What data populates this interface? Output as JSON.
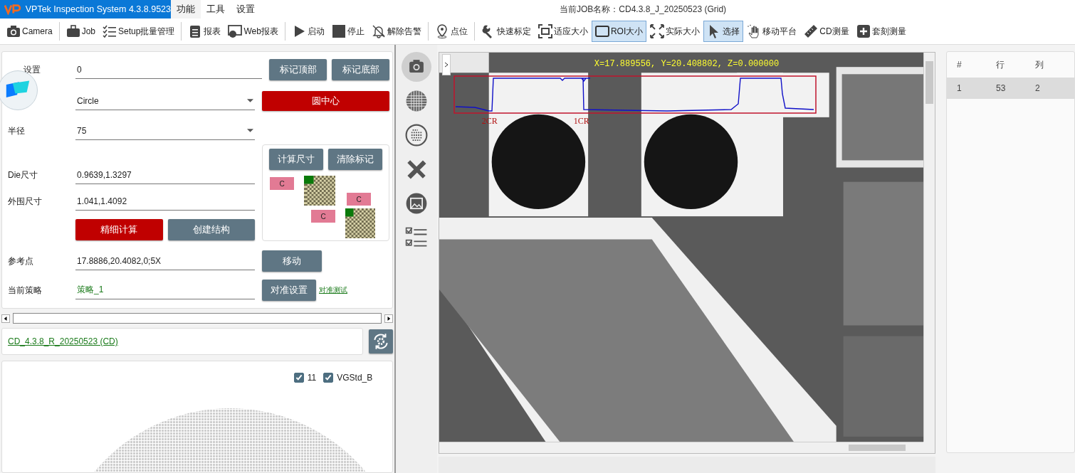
{
  "window": {
    "app_title": "VPTek Inspection System 4.3.8.9523",
    "menu": [
      {
        "label": "功能",
        "selected": true
      },
      {
        "label": "工具",
        "selected": false
      },
      {
        "label": "设置",
        "selected": false
      }
    ],
    "job_title": "当前JOB名称：CD4.3.8_J_20250523 (Grid)"
  },
  "toolbar": {
    "groups": [
      [
        {
          "label": "Camera",
          "selected": false
        }
      ],
      [
        {
          "label": "Job",
          "selected": false
        },
        {
          "label": "Setup批量管理",
          "selected": false
        }
      ],
      [
        {
          "label": "报表",
          "selected": false
        },
        {
          "label": "Web报表",
          "selected": false
        }
      ],
      [
        {
          "label": "启动",
          "selected": false
        },
        {
          "label": "停止",
          "selected": false
        },
        {
          "label": "解除告警",
          "selected": false
        }
      ],
      [
        {
          "label": "点位",
          "selected": false
        }
      ],
      [
        {
          "label": "快速标定",
          "selected": false
        },
        {
          "label": "适应大小",
          "selected": false
        },
        {
          "label": "ROI大小",
          "selected": true
        },
        {
          "label": "实际大小",
          "selected": false
        },
        {
          "label": "选择",
          "selected": true
        },
        {
          "label": "移动平台",
          "selected": false
        },
        {
          "label": "CD测量",
          "selected": false
        },
        {
          "label": "套刻测量",
          "selected": false
        }
      ]
    ]
  },
  "form": {
    "rows": [
      {
        "label": "设置",
        "value": "0",
        "kind": "text"
      },
      {
        "value": "Circle",
        "kind": "dropdown"
      },
      {
        "label": "半径",
        "value": "75",
        "kind": "dropdown"
      },
      {
        "label": "Die尺寸",
        "value": "0.9639,1.3297",
        "kind": "text"
      },
      {
        "label": "外围尺寸",
        "value": "1.041,1.4092",
        "kind": "text"
      },
      {
        "label": "参考点",
        "value": "17.8886,20.4082,0;5X",
        "kind": "text"
      },
      {
        "label": "当前策略",
        "value": "策略_1",
        "kind": "strategy"
      }
    ],
    "buttons": [
      {
        "label": "标记顶部",
        "primary": false
      },
      {
        "label": "标记底部",
        "primary": false
      },
      {
        "label": "圆中心",
        "primary": true
      },
      {
        "label": "计算尺寸",
        "primary": false
      },
      {
        "label": "清除标记",
        "primary": false
      },
      {
        "label": "精细计算",
        "primary": true
      },
      {
        "label": "创建结构",
        "primary": false
      },
      {
        "label": "移动",
        "primary": false
      },
      {
        "label": "对准设置",
        "primary": false
      }
    ],
    "align_test_link": "对准测试",
    "structure_nodes": [
      "C",
      "C",
      "C"
    ]
  },
  "job": {
    "link": "CD_4.3.8_R_20250523 (CD)"
  },
  "wafer": {
    "legend": [
      {
        "label": "11",
        "checked": true
      },
      {
        "label": "VGStd_B",
        "checked": true
      }
    ]
  },
  "side_tools": [
    {
      "selected": true
    },
    {
      "selected": false
    },
    {
      "selected": false
    },
    {
      "selected": false
    },
    {
      "selected": false
    },
    {
      "selected": false
    }
  ],
  "image": {
    "coordinates": "X=17.889556, Y=20.408802, Z=0.000000",
    "edge_labels": [
      "2CR",
      "1CR"
    ]
  },
  "results": {
    "columns": [
      "#",
      "行",
      "列"
    ],
    "rows": [
      {
        "cells": [
          "1",
          "53",
          "2"
        ],
        "selected": true
      }
    ]
  }
}
